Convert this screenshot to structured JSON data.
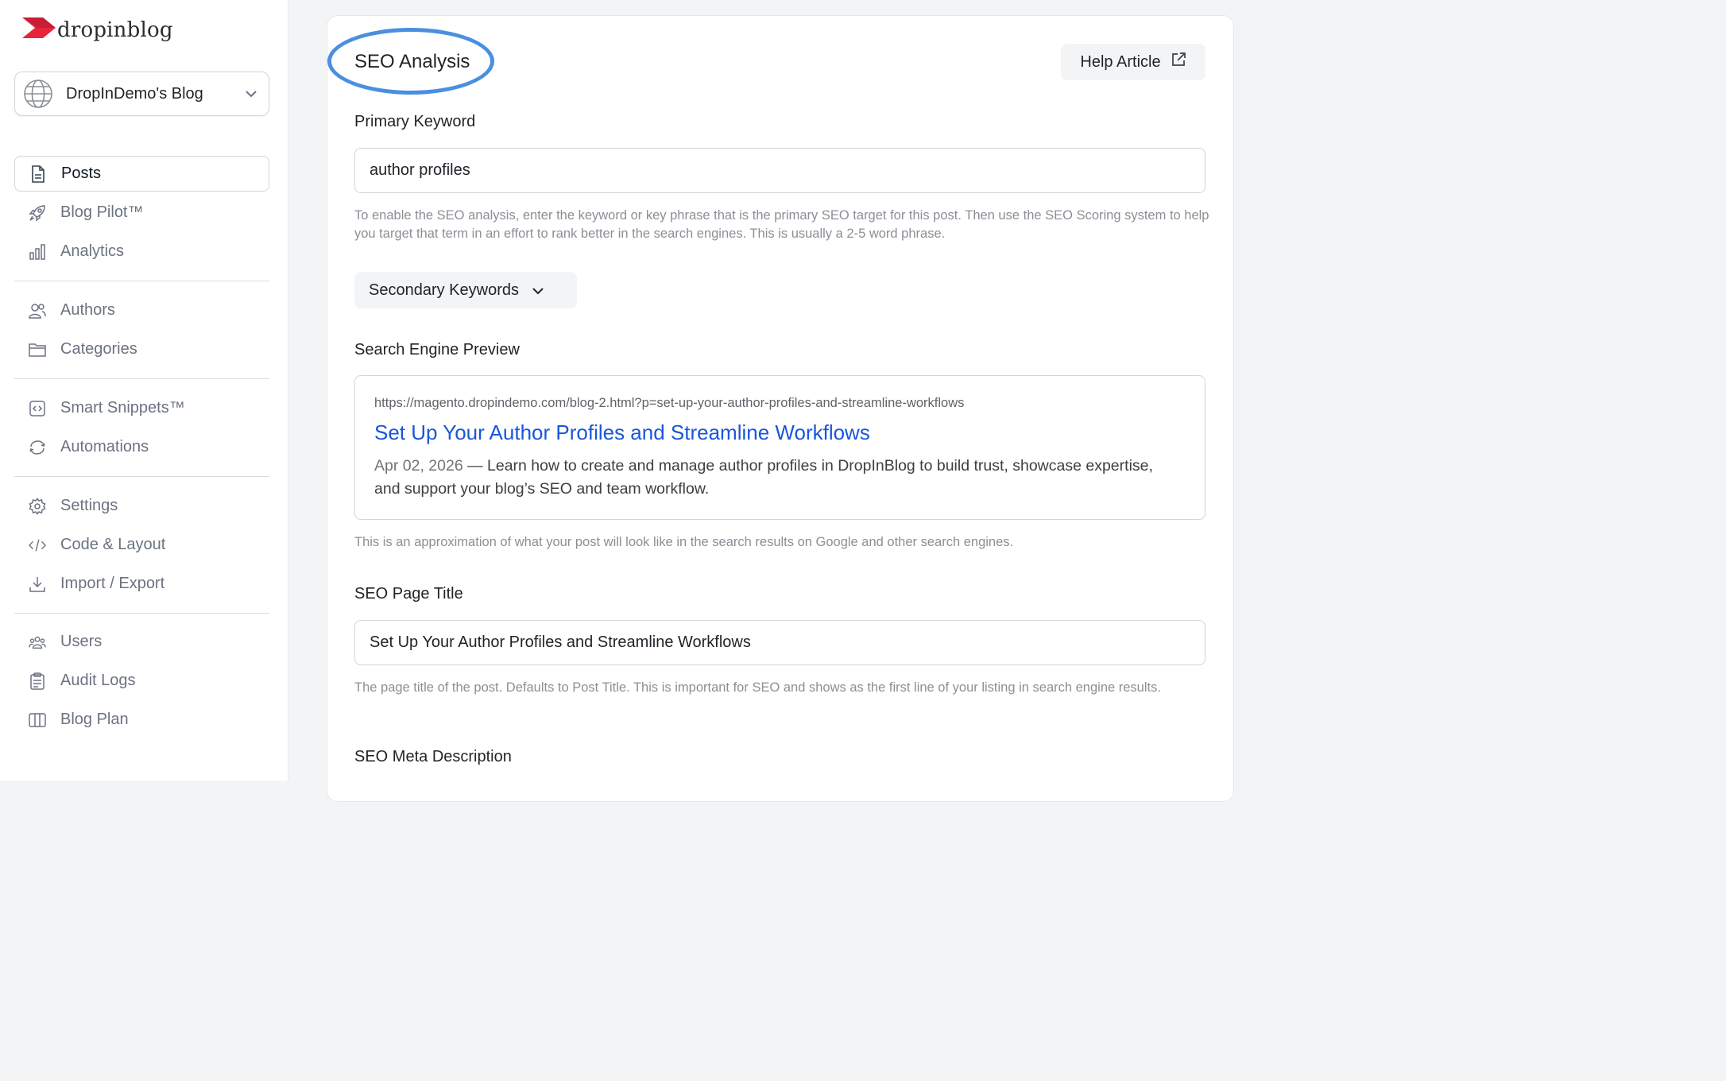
{
  "app": {
    "logo_text": "dropinblog",
    "brand_color": "#e8243c"
  },
  "blog_selector": {
    "name": "DropInDemo's Blog",
    "icon": "globe-icon"
  },
  "sidebar": {
    "groups": [
      [
        {
          "label": "Posts",
          "icon": "document-icon",
          "active": true
        },
        {
          "label": "Blog Pilot™",
          "icon": "rocket-icon"
        },
        {
          "label": "Analytics",
          "icon": "bar-chart-icon"
        }
      ],
      [
        {
          "label": "Authors",
          "icon": "users-icon"
        },
        {
          "label": "Categories",
          "icon": "folder-icon"
        }
      ],
      [
        {
          "label": "Smart Snippets™",
          "icon": "code-box-icon"
        },
        {
          "label": "Automations",
          "icon": "refresh-icon"
        }
      ],
      [
        {
          "label": "Settings",
          "icon": "gear-icon"
        },
        {
          "label": "Code & Layout",
          "icon": "code-icon"
        },
        {
          "label": "Import / Export",
          "icon": "download-icon"
        }
      ],
      [
        {
          "label": "Users",
          "icon": "user-group-icon"
        },
        {
          "label": "Audit Logs",
          "icon": "clipboard-icon"
        },
        {
          "label": "Blog Plan",
          "icon": "columns-icon"
        }
      ]
    ]
  },
  "seo": {
    "title": "SEO Analysis",
    "highlight_color": "#4a8fe0",
    "help_button": "Help Article",
    "primary_keyword": {
      "label": "Primary Keyword",
      "value": "author profiles",
      "help": "To enable the SEO analysis, enter the keyword or key phrase that is the primary SEO target for this post. Then use the SEO Scoring system to help you target that term in an effort to rank better in the search engines. This is usually a 2-5 word phrase."
    },
    "secondary_keywords_label": "Secondary Keywords",
    "preview": {
      "label": "Search Engine Preview",
      "url": "https://magento.dropindemo.com/blog-2.html?p=set-up-your-author-profiles-and-streamline-workflows",
      "title": "Set Up Your Author Profiles and Streamline Workflows",
      "date": "Apr 02, 2026",
      "description": " — Learn how to create and manage author profiles in DropInBlog to build trust, showcase expertise, and support your blog’s SEO and team workflow.",
      "help": "This is an approximation of what your post will look like in the search results on Google and other search engines.",
      "link_color": "#1a56db"
    },
    "page_title": {
      "label": "SEO Page Title",
      "value": "Set Up Your Author Profiles and Streamline Workflows",
      "help": "The page title of the post. Defaults to Post Title. This is important for SEO and shows as the first line of your listing in search engine results."
    },
    "meta_description_label": "SEO Meta Description"
  }
}
